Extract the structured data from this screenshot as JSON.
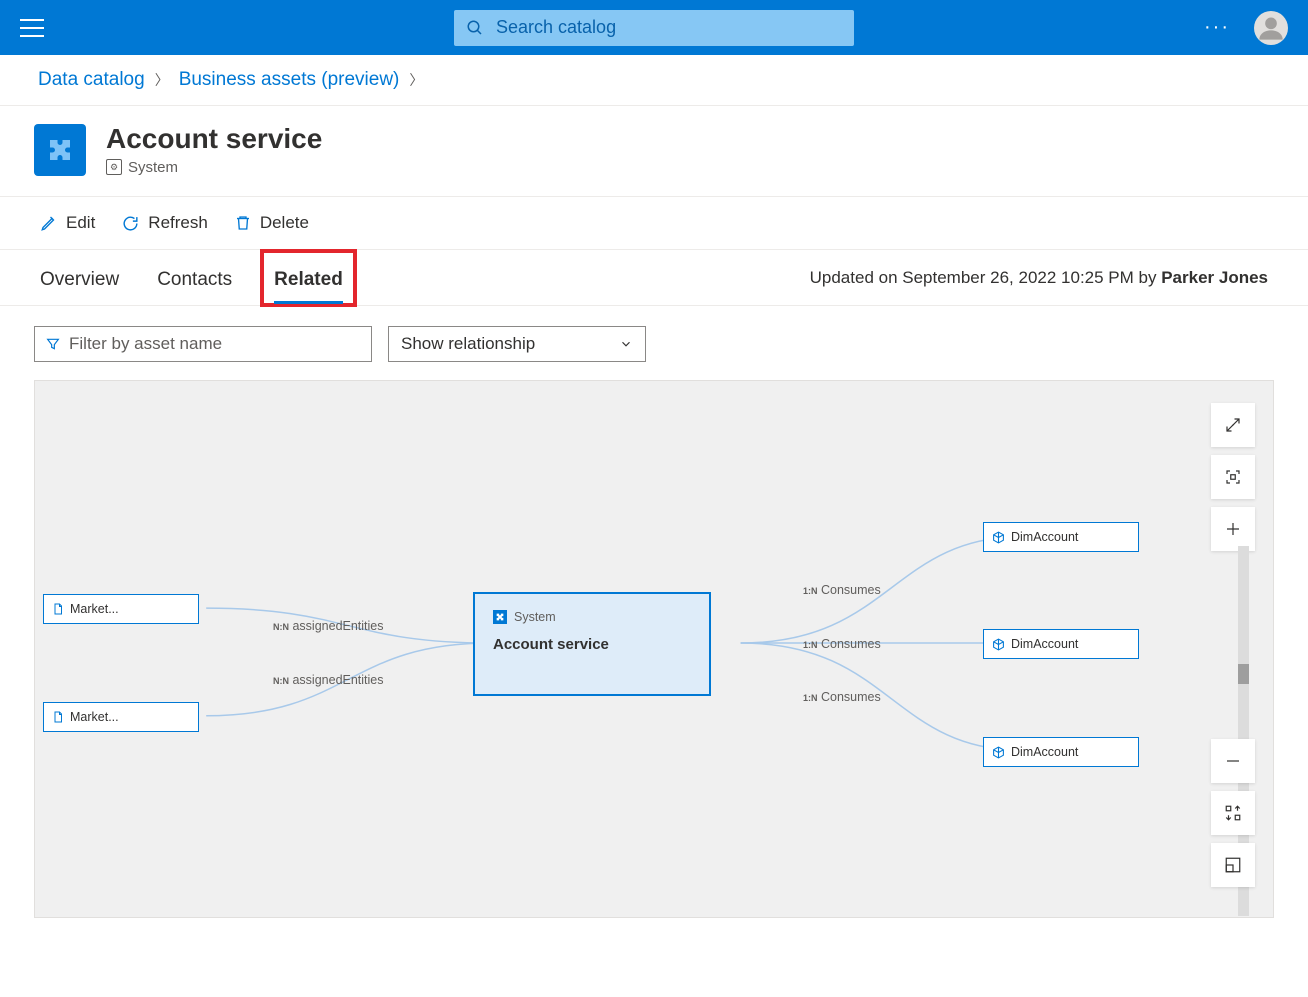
{
  "topbar": {
    "search_placeholder": "Search catalog",
    "more": "···"
  },
  "breadcrumb": {
    "item1": "Data catalog",
    "item2": "Business assets (preview)"
  },
  "header": {
    "title": "Account service",
    "subtype": "System"
  },
  "actions": {
    "edit": "Edit",
    "refresh": "Refresh",
    "delete": "Delete"
  },
  "tabs": {
    "overview": "Overview",
    "contacts": "Contacts",
    "related": "Related"
  },
  "updated": {
    "prefix": "Updated on September 26, 2022 10:25 PM by ",
    "user": "Parker Jones"
  },
  "filters": {
    "filter_placeholder": "Filter by asset name",
    "relationship": "Show relationship"
  },
  "graph": {
    "left1": "Market...",
    "left2": "Market...",
    "center_type": "System",
    "center_name": "Account service",
    "right1": "DimAccount",
    "right2": "DimAccount",
    "right3": "DimAccount",
    "edge_left_rel_tag": "N:N",
    "edge_left_rel": "assignedEntities",
    "edge_right_rel_tag": "1:N",
    "edge_right_rel": "Consumes"
  }
}
